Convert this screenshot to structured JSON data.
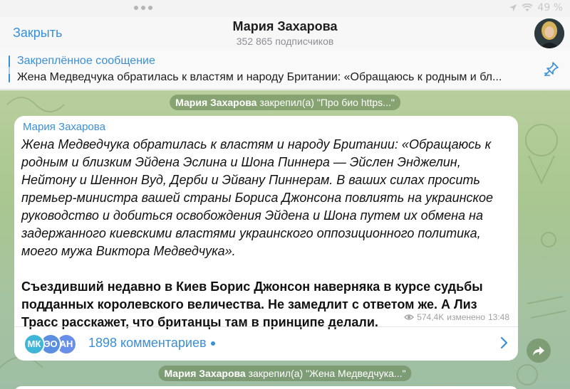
{
  "status_bar": {
    "battery": "49 %"
  },
  "header": {
    "close_label": "Закрыть",
    "title": "Мария Захарова",
    "subtitle": "352 865 подписчиков"
  },
  "pinned": {
    "title": "Закреплённое сообщение",
    "text": "Жена Медведчука обратилась к властям и народу Британии:  «Обращаюсь к родным и бл..."
  },
  "chat": {
    "service_top": {
      "name": "Мария Захарова",
      "text": " закрепил(а) \"Про био   https...\""
    },
    "message": {
      "author": "Мария Захарова",
      "paragraph_italic": "Жена Медведчука обратилась к властям и народу Британии:  «Обращаюсь к родным и близким Эйдена Эслина и Шона Пиннера — Эйслен Энджелин, Нейтону и Шеннон Вуд, Дерби и Эйвану Пиннерам. В ваших силах просить премьер-министра вашей страны Бориса Джонсона повлиять на украинское руководство и добиться освобождения Эйдена и Шона путем их обмена на задержанного киевскими властями украинского оппозиционного политика, моего мужа Виктора Медведчука».",
      "paragraph_bold": "Съездивший недавно  в Киев Борис Джонсон наверняка в курсе судьбы подданных  королевского величества. Не замедлит с ответом же. А Лиз Трасс расскажет, что британцы там в принципе делали.",
      "views": "574,4K",
      "edited": "изменено",
      "time": "13:48",
      "comment_avatars": [
        {
          "initials": "МК",
          "color": "#3fb6d8"
        },
        {
          "initials": "ЭО",
          "color": "#5b8fe0"
        },
        {
          "initials": "АН",
          "color": "#6a8fe8"
        }
      ],
      "comments_label": "1898 комментариев"
    },
    "service_bottom": {
      "name": "Мария Захарова",
      "text": " закрепил(а) \"Жена Медведчука...\""
    }
  }
}
